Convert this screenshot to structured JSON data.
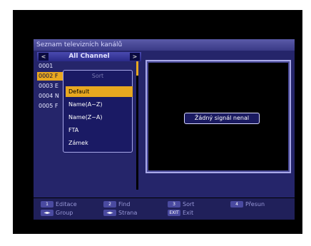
{
  "title": "Seznam televizních kanálů",
  "list_header": {
    "label": "All Channel",
    "left_arrow": "<",
    "right_arrow": ">"
  },
  "channels": [
    {
      "number": "0001",
      "name": ""
    },
    {
      "number": "0002",
      "name": "F"
    },
    {
      "number": "0003",
      "name": "E"
    },
    {
      "number": "0004",
      "name": "N"
    },
    {
      "number": "0005",
      "name": "F"
    }
  ],
  "selected_channel_index": 1,
  "preview": {
    "message": "Žádný signál nenal"
  },
  "sort_popup": {
    "title": "Sort",
    "options": [
      "Default",
      "Name(A~Z)",
      "Name(Z~A)",
      "FTA",
      "Zámek"
    ],
    "selected_index": 0
  },
  "footer": {
    "keys": [
      {
        "chip": "1",
        "label": "Editace"
      },
      {
        "chip": "2",
        "label": "Find"
      },
      {
        "chip": "3",
        "label": "Sort"
      },
      {
        "chip": "4",
        "label": "Přesun"
      },
      {
        "chip": "◄►",
        "label": "Group"
      },
      {
        "chip": "◄►",
        "label": "Strana"
      },
      {
        "chip": "EXIT",
        "label": "Exit"
      }
    ]
  },
  "colors": {
    "panel": "#25256a",
    "highlight": "#e8a820",
    "text": "#e8e8ff"
  }
}
